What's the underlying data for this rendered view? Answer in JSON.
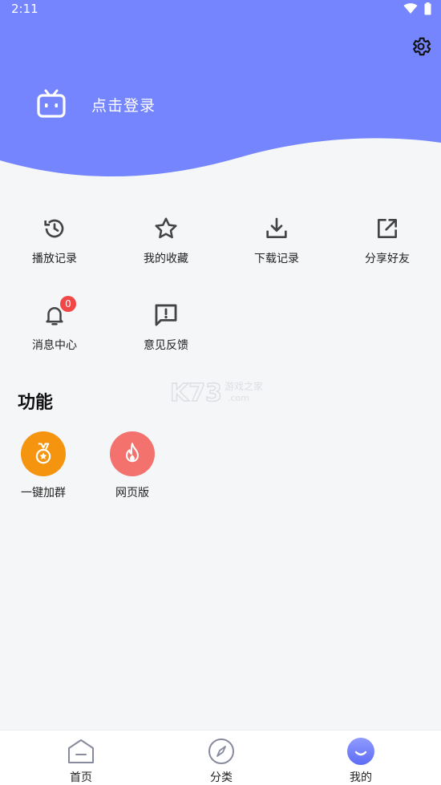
{
  "status_bar": {
    "time": "2:11"
  },
  "colors": {
    "header": "#7585fd",
    "accent": "#6f7dfb",
    "badge": "#f34646",
    "feature_orange": "#f5940f",
    "feature_red": "#f3726d"
  },
  "header": {
    "login_label": "点击登录",
    "settings_icon": "gear-icon",
    "avatar_icon": "tv-icon"
  },
  "quick_grid": [
    {
      "label": "播放记录",
      "icon": "history-icon"
    },
    {
      "label": "我的收藏",
      "icon": "star-icon"
    },
    {
      "label": "下载记录",
      "icon": "download-icon"
    },
    {
      "label": "分享好友",
      "icon": "share-icon"
    },
    {
      "label": "消息中心",
      "icon": "bell-icon",
      "badge": "0"
    },
    {
      "label": "意见反馈",
      "icon": "feedback-icon"
    }
  ],
  "features": {
    "title": "功能",
    "items": [
      {
        "label": "一键加群",
        "icon": "medal-icon"
      },
      {
        "label": "网页版",
        "icon": "flame-icon"
      }
    ]
  },
  "bottom_nav": [
    {
      "label": "首页",
      "icon": "home-icon"
    },
    {
      "label": "分类",
      "icon": "compass-icon"
    },
    {
      "label": "我的",
      "icon": "smile-icon",
      "active": true
    }
  ]
}
